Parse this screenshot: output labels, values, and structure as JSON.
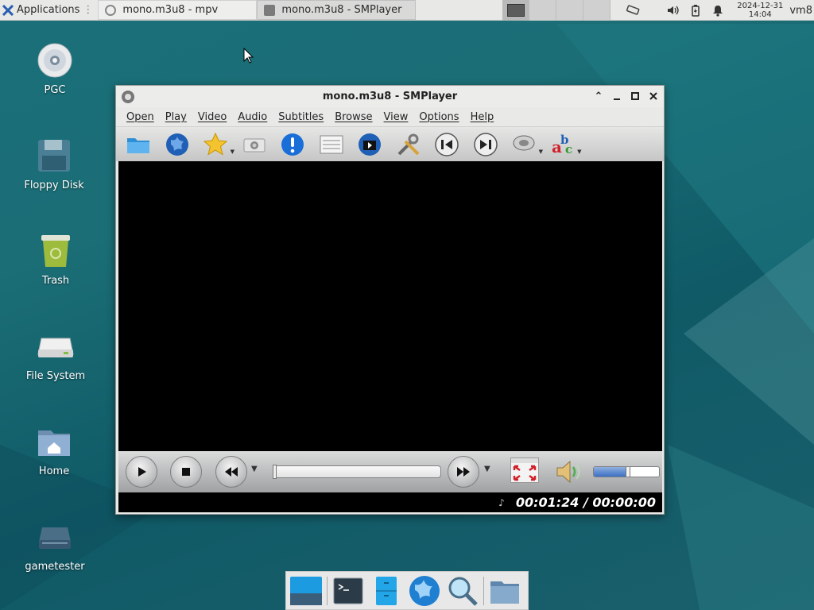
{
  "top_panel": {
    "apps_label": "Applications",
    "tasks": [
      {
        "label": "mono.m3u8 - mpv",
        "active": false
      },
      {
        "label": "mono.m3u8 - SMPlayer",
        "active": true
      }
    ],
    "clock": {
      "date": "2024-12-31",
      "time": "14:04"
    },
    "user": "vm8"
  },
  "desktop": {
    "icons": [
      {
        "label": "PGC",
        "icon": "cd-disc-icon"
      },
      {
        "label": "Floppy Disk",
        "icon": "floppy-icon"
      },
      {
        "label": "Trash",
        "icon": "trash-icon"
      },
      {
        "label": "File System",
        "icon": "drive-icon"
      },
      {
        "label": "Home",
        "icon": "home-folder-icon"
      },
      {
        "label": "gametester",
        "icon": "drive-icon"
      }
    ]
  },
  "player": {
    "title": "mono.m3u8 - SMPlayer",
    "menu": [
      "Open",
      "Play",
      "Video",
      "Audio",
      "Subtitles",
      "Browse",
      "View",
      "Options",
      "Help"
    ],
    "toolbar": [
      "open-folder-icon",
      "globe-icon",
      "favorites-star-icon",
      "screenshot-camera-icon",
      "info-icon",
      "playlist-icon",
      "video-clapper-icon",
      "preferences-tools-icon",
      "previous-icon",
      "next-icon",
      "audio-track-icon",
      "subtitles-abc-icon"
    ],
    "status": {
      "time": "00:01:24 / 00:00:00"
    },
    "volume_fraction": 0.52,
    "seek_fraction": 0.0
  },
  "dock": {
    "items": [
      "desktop-icon",
      "terminal-icon",
      "file-manager-icon",
      "web-browser-icon",
      "search-icon",
      "folder-icon"
    ]
  },
  "colors": {
    "accent": "#3c6fc4",
    "desktop_bg": "#1a6f79"
  }
}
